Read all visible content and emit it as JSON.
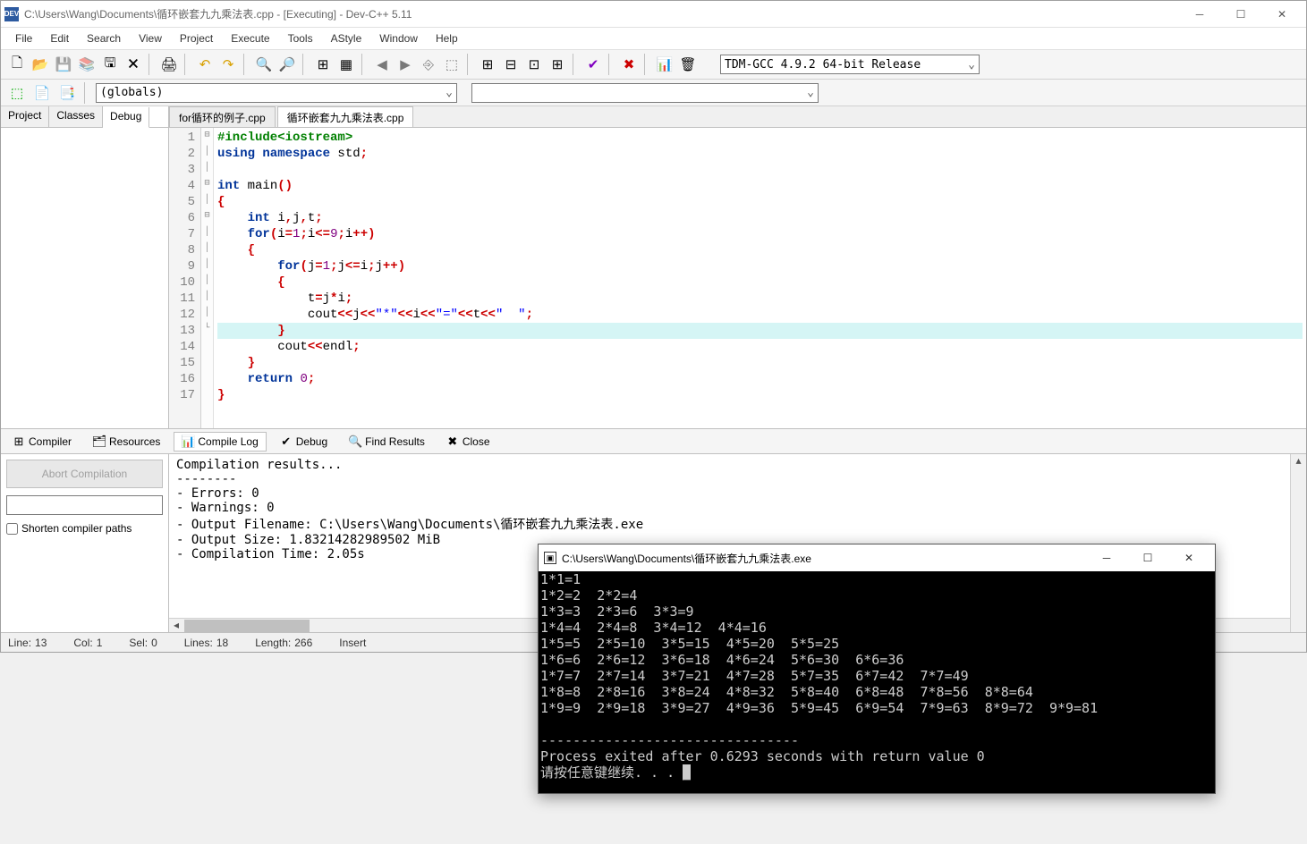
{
  "window": {
    "title": "C:\\Users\\Wang\\Documents\\循环嵌套九九乘法表.cpp - [Executing] - Dev-C++ 5.11"
  },
  "menu": [
    "File",
    "Edit",
    "Search",
    "View",
    "Project",
    "Execute",
    "Tools",
    "AStyle",
    "Window",
    "Help"
  ],
  "compiler_combo": "TDM-GCC 4.9.2 64-bit Release",
  "globals_combo": "(globals)",
  "left_tabs": [
    "Project",
    "Classes",
    "Debug"
  ],
  "left_active": 2,
  "file_tabs": [
    "for循环的例子.cpp",
    "循环嵌套九九乘法表.cpp"
  ],
  "file_active": 1,
  "code": {
    "highlight_line": 13,
    "lines": [
      {
        "n": 1,
        "fold": "",
        "tokens": [
          {
            "c": "pp",
            "t": "#include<iostream>"
          }
        ]
      },
      {
        "n": 2,
        "fold": "",
        "tokens": [
          {
            "c": "kw",
            "t": "using namespace"
          },
          {
            "c": "id",
            "t": " std"
          },
          {
            "c": "op",
            "t": ";"
          }
        ]
      },
      {
        "n": 3,
        "fold": "",
        "tokens": []
      },
      {
        "n": 4,
        "fold": "",
        "tokens": [
          {
            "c": "kw",
            "t": "int"
          },
          {
            "c": "id",
            "t": " main"
          },
          {
            "c": "op",
            "t": "()"
          }
        ]
      },
      {
        "n": 5,
        "fold": "-",
        "tokens": [
          {
            "c": "op",
            "t": "{"
          }
        ]
      },
      {
        "n": 6,
        "fold": "|",
        "tokens": [
          {
            "c": "id",
            "t": "    "
          },
          {
            "c": "kw",
            "t": "int"
          },
          {
            "c": "id",
            "t": " i"
          },
          {
            "c": "op",
            "t": ","
          },
          {
            "c": "id",
            "t": "j"
          },
          {
            "c": "op",
            "t": ","
          },
          {
            "c": "id",
            "t": "t"
          },
          {
            "c": "op",
            "t": ";"
          }
        ]
      },
      {
        "n": 7,
        "fold": "|",
        "tokens": [
          {
            "c": "id",
            "t": "    "
          },
          {
            "c": "kw",
            "t": "for"
          },
          {
            "c": "op",
            "t": "("
          },
          {
            "c": "id",
            "t": "i"
          },
          {
            "c": "op",
            "t": "="
          },
          {
            "c": "num",
            "t": "1"
          },
          {
            "c": "op",
            "t": ";"
          },
          {
            "c": "id",
            "t": "i"
          },
          {
            "c": "op",
            "t": "<="
          },
          {
            "c": "num",
            "t": "9"
          },
          {
            "c": "op",
            "t": ";"
          },
          {
            "c": "id",
            "t": "i"
          },
          {
            "c": "op",
            "t": "++)"
          }
        ]
      },
      {
        "n": 8,
        "fold": "-",
        "tokens": [
          {
            "c": "id",
            "t": "    "
          },
          {
            "c": "op",
            "t": "{"
          }
        ]
      },
      {
        "n": 9,
        "fold": "|",
        "tokens": [
          {
            "c": "id",
            "t": "        "
          },
          {
            "c": "kw",
            "t": "for"
          },
          {
            "c": "op",
            "t": "("
          },
          {
            "c": "id",
            "t": "j"
          },
          {
            "c": "op",
            "t": "="
          },
          {
            "c": "num",
            "t": "1"
          },
          {
            "c": "op",
            "t": ";"
          },
          {
            "c": "id",
            "t": "j"
          },
          {
            "c": "op",
            "t": "<="
          },
          {
            "c": "id",
            "t": "i"
          },
          {
            "c": "op",
            "t": ";"
          },
          {
            "c": "id",
            "t": "j"
          },
          {
            "c": "op",
            "t": "++)"
          }
        ]
      },
      {
        "n": 10,
        "fold": "-",
        "tokens": [
          {
            "c": "id",
            "t": "        "
          },
          {
            "c": "op",
            "t": "{"
          }
        ]
      },
      {
        "n": 11,
        "fold": "|",
        "tokens": [
          {
            "c": "id",
            "t": "            t"
          },
          {
            "c": "op",
            "t": "="
          },
          {
            "c": "id",
            "t": "j"
          },
          {
            "c": "op",
            "t": "*"
          },
          {
            "c": "id",
            "t": "i"
          },
          {
            "c": "op",
            "t": ";"
          }
        ]
      },
      {
        "n": 12,
        "fold": "|",
        "tokens": [
          {
            "c": "id",
            "t": "            cout"
          },
          {
            "c": "op",
            "t": "<<"
          },
          {
            "c": "id",
            "t": "j"
          },
          {
            "c": "op",
            "t": "<<"
          },
          {
            "c": "str",
            "t": "\"*\""
          },
          {
            "c": "op",
            "t": "<<"
          },
          {
            "c": "id",
            "t": "i"
          },
          {
            "c": "op",
            "t": "<<"
          },
          {
            "c": "str",
            "t": "\"=\""
          },
          {
            "c": "op",
            "t": "<<"
          },
          {
            "c": "id",
            "t": "t"
          },
          {
            "c": "op",
            "t": "<<"
          },
          {
            "c": "str",
            "t": "\"  \""
          },
          {
            "c": "op",
            "t": ";"
          }
        ]
      },
      {
        "n": 13,
        "fold": "|",
        "tokens": [
          {
            "c": "id",
            "t": "        "
          },
          {
            "c": "op",
            "t": "}"
          }
        ]
      },
      {
        "n": 14,
        "fold": "|",
        "tokens": [
          {
            "c": "id",
            "t": "        cout"
          },
          {
            "c": "op",
            "t": "<<"
          },
          {
            "c": "id",
            "t": "endl"
          },
          {
            "c": "op",
            "t": ";"
          }
        ]
      },
      {
        "n": 15,
        "fold": "|",
        "tokens": [
          {
            "c": "id",
            "t": "    "
          },
          {
            "c": "op",
            "t": "}"
          }
        ]
      },
      {
        "n": 16,
        "fold": "|",
        "tokens": [
          {
            "c": "id",
            "t": "    "
          },
          {
            "c": "kw",
            "t": "return"
          },
          {
            "c": "id",
            "t": " "
          },
          {
            "c": "num",
            "t": "0"
          },
          {
            "c": "op",
            "t": ";"
          }
        ]
      },
      {
        "n": 17,
        "fold": "L",
        "tokens": [
          {
            "c": "op",
            "t": "}"
          }
        ]
      }
    ]
  },
  "bottom_tabs": [
    {
      "icon": "⊞",
      "label": "Compiler"
    },
    {
      "icon": "🗂",
      "label": "Resources"
    },
    {
      "icon": "📊",
      "label": "Compile Log"
    },
    {
      "icon": "✔",
      "label": "Debug"
    },
    {
      "icon": "🔍",
      "label": "Find Results"
    },
    {
      "icon": "✖",
      "label": "Close"
    }
  ],
  "bottom_active": 2,
  "abort_label": "Abort Compilation",
  "shorten_label": "Shorten compiler paths",
  "compile_log": "Compilation results...\n--------\n- Errors: 0\n- Warnings: 0\n- Output Filename: C:\\Users\\Wang\\Documents\\循环嵌套九九乘法表.exe\n- Output Size: 1.83214282989502 MiB\n- Compilation Time: 2.05s",
  "status": {
    "line_lbl": "Line:",
    "line": "13",
    "col_lbl": "Col:",
    "col": "1",
    "sel_lbl": "Sel:",
    "sel": "0",
    "lines_lbl": "Lines:",
    "lines": "18",
    "len_lbl": "Length:",
    "len": "266",
    "mode": "Insert"
  },
  "console": {
    "title": "C:\\Users\\Wang\\Documents\\循环嵌套九九乘法表.exe",
    "output": "1*1=1\n1*2=2  2*2=4\n1*3=3  2*3=6  3*3=9\n1*4=4  2*4=8  3*4=12  4*4=16\n1*5=5  2*5=10  3*5=15  4*5=20  5*5=25\n1*6=6  2*6=12  3*6=18  4*6=24  5*6=30  6*6=36\n1*7=7  2*7=14  3*7=21  4*7=28  5*7=35  6*7=42  7*7=49\n1*8=8  2*8=16  3*8=24  4*8=32  5*8=40  6*8=48  7*8=56  8*8=64\n1*9=9  2*9=18  3*9=27  4*9=36  5*9=45  6*9=54  7*9=63  8*9=72  9*9=81\n\n--------------------------------\nProcess exited after 0.6293 seconds with return value 0\n请按任意键继续. . . "
  }
}
